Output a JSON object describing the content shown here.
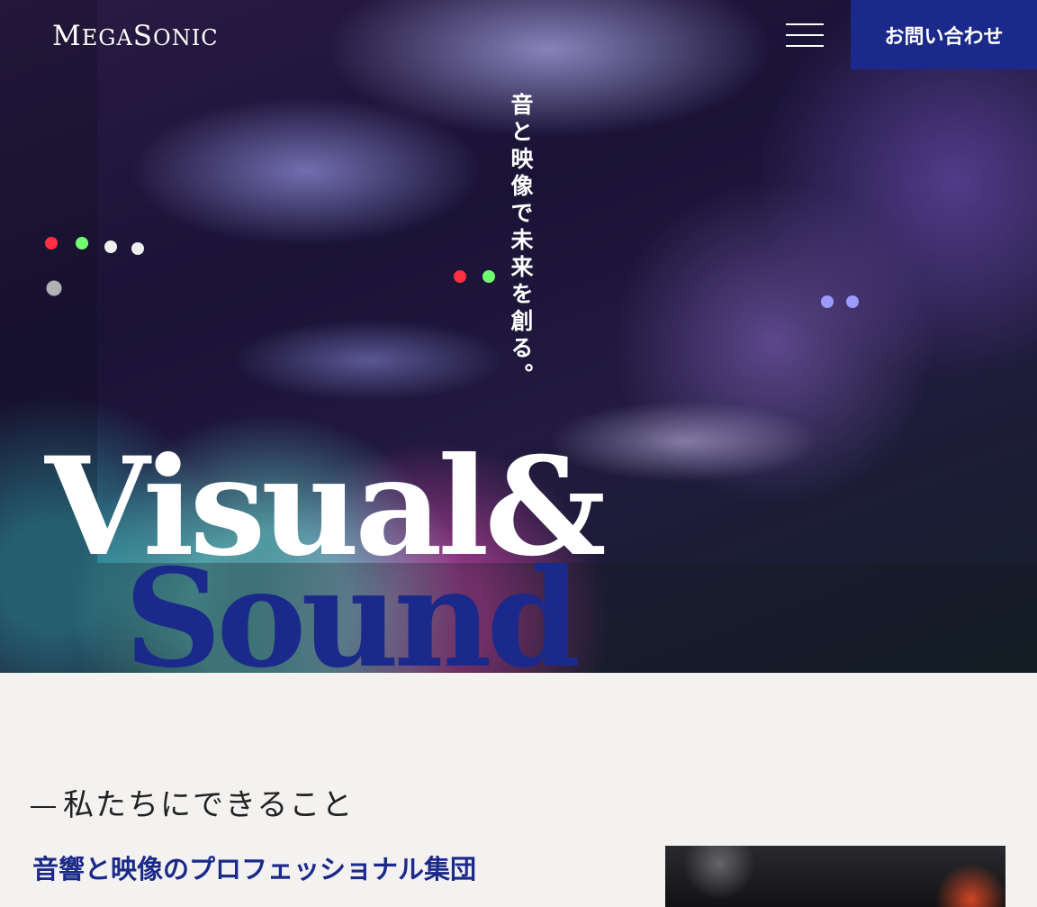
{
  "header": {
    "logo": {
      "first": "M",
      "first_small": "EGA",
      "second": "S",
      "second_small": "ONIC"
    },
    "menu_icon": "hamburger-icon",
    "contact_label": "お問い合わせ"
  },
  "hero": {
    "tagline": "音と映像で未来を創る。",
    "title_line1": "Visual&",
    "title_line2": "Sound"
  },
  "section": {
    "label": "私たちにできること",
    "heading": "音響と映像のプロフェッショナル集団"
  },
  "colors": {
    "brand": "#1b2a8a",
    "background": "#f3f2f0",
    "text": "#222222"
  }
}
